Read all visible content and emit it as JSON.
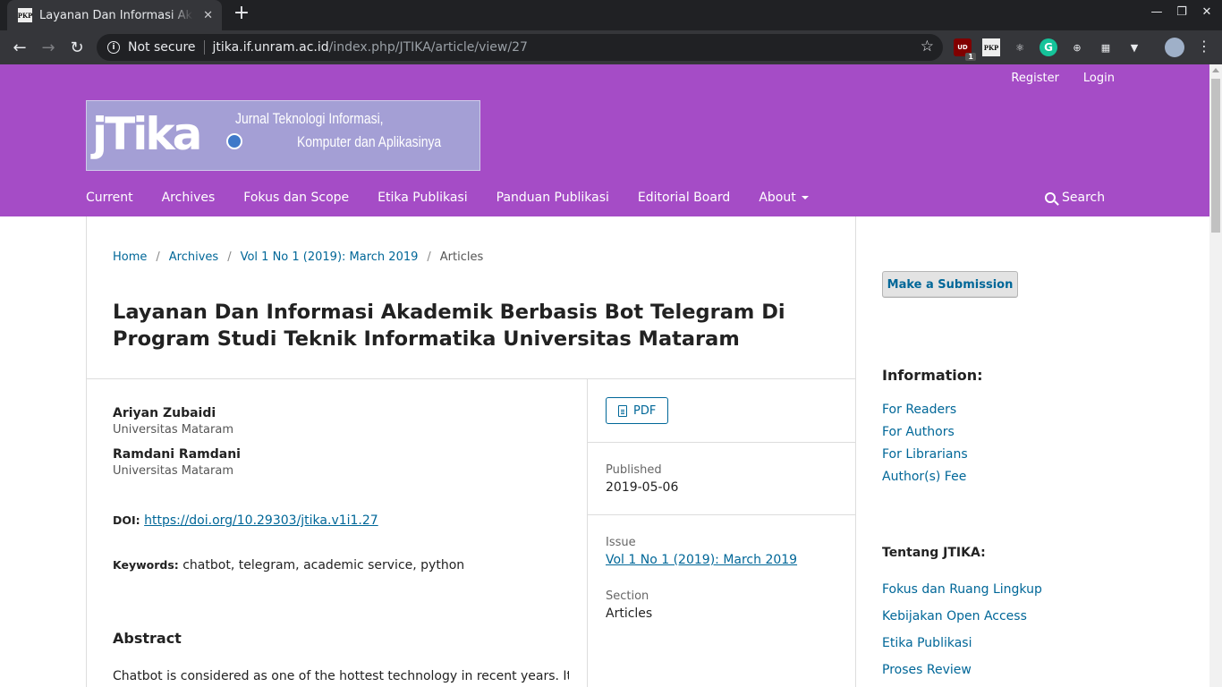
{
  "browser": {
    "tab_title": "Layanan Dan Informasi Akademik Berbasis Bot Telegram",
    "favicon_text": "PKP",
    "security_label": "Not secure",
    "url_host": "jtika.if.unram.ac.id",
    "url_path": "/index.php/JTIKA/article/view/27",
    "ext_ublock_text": "UD",
    "ext_ublock_badge": "1",
    "ext_pkp_text": "PKP",
    "ext_grammarly_text": "G",
    "icons": [
      "back-icon",
      "forward-icon",
      "reload-icon",
      "info-icon",
      "star-icon",
      "minimize-icon",
      "maximize-icon",
      "close-icon"
    ]
  },
  "header": {
    "user_links": [
      "Register",
      "Login"
    ],
    "logo_wordmark": "jTika",
    "logo_line1": "Jurnal Teknologi Informasi,",
    "logo_line2": "Komputer dan Aplikasinya",
    "nav": [
      "Current",
      "Archives",
      "Fokus dan Scope",
      "Etika Publikasi",
      "Panduan Publikasi",
      "Editorial Board",
      "About"
    ],
    "search_label": "Search",
    "bg_color": "#a54cc6"
  },
  "breadcrumb": {
    "home": "Home",
    "archives": "Archives",
    "issue": "Vol 1 No 1 (2019): March 2019",
    "current": "Articles",
    "separator": "/"
  },
  "article": {
    "title": "Layanan Dan Informasi Akademik Berbasis Bot Telegram Di Program Studi Teknik Informatika Universitas Mataram",
    "authors": [
      {
        "name": "Ariyan Zubaidi",
        "affiliation": "Universitas Mataram"
      },
      {
        "name": "Ramdani Ramdani",
        "affiliation": "Universitas Mataram"
      }
    ],
    "doi_label": "DOI:",
    "doi_url": "https://doi.org/10.29303/jtika.v1i1.27",
    "keywords_label": "Keywords:",
    "keywords": "chatbot, telegram, academic service, python",
    "abstract_heading": "Abstract",
    "abstract_start": "Chatbot is considered as one of the hottest technology in recent years. It is",
    "pdf_label": "PDF",
    "published_label": "Published",
    "published_date": "2019-05-06",
    "issue_label": "Issue",
    "issue_value": "Vol 1 No 1 (2019): March 2019",
    "section_label": "Section",
    "section_value": "Articles"
  },
  "sidebar": {
    "submit_label": "Make a Submission",
    "information_heading": "Information:",
    "information_links": [
      "For Readers",
      "For Authors",
      "For Librarians",
      "Author(s) Fee"
    ],
    "tentang_heading": "Tentang JTIKA:",
    "tentang_links": [
      "Fokus dan Ruang Lingkup",
      "Kebijakan Open Access",
      "Etika Publikasi",
      "Proses Review"
    ]
  },
  "colors": {
    "link": "#006798",
    "accent": "#a54cc6"
  }
}
